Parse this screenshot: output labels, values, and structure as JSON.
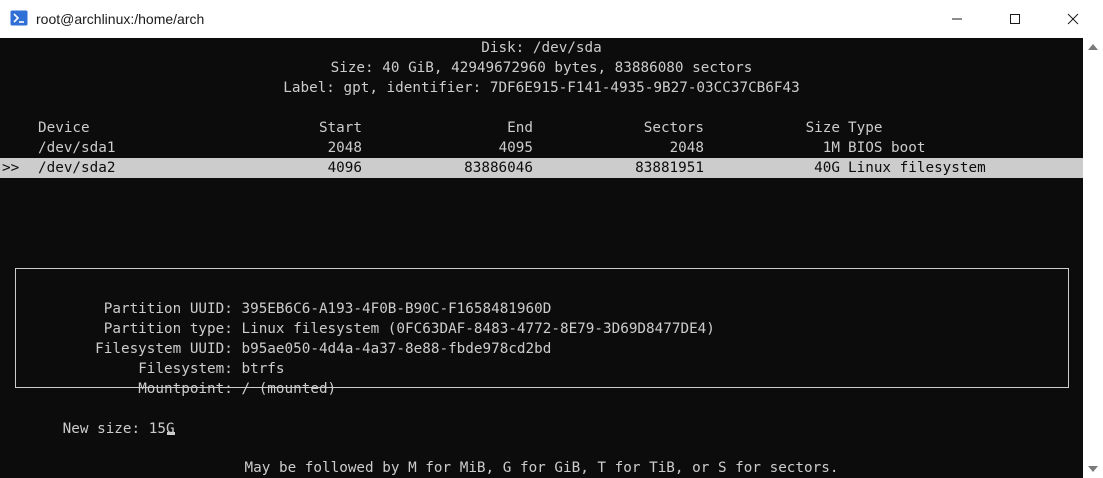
{
  "window": {
    "title": "root@archlinux:/home/arch"
  },
  "disk_header": {
    "disk": "Disk: /dev/sda",
    "size": "Size: 40 GiB, 42949672960 bytes, 83886080 sectors",
    "label": "Label: gpt, identifier: 7DF6E915-F141-4935-9B27-03CC37CB6F43"
  },
  "table": {
    "columns": {
      "device": "Device",
      "start": "Start",
      "end": "End",
      "sectors": "Sectors",
      "size": "Size",
      "type": "Type"
    },
    "rows": [
      {
        "marker": "",
        "device": "/dev/sda1",
        "start": "2048",
        "end": "4095",
        "sectors": "2048",
        "size": "1M",
        "type": "BIOS boot"
      },
      {
        "marker": ">>",
        "device": "/dev/sda2",
        "start": "4096",
        "end": "83886046",
        "sectors": "83881951",
        "size": "40G",
        "type": "Linux filesystem"
      }
    ]
  },
  "partition_info": {
    "uuid_label": "Partition UUID:",
    "uuid_value": "395EB6C6-A193-4F0B-B90C-F1658481960D",
    "type_label": "Partition type:",
    "type_value": "Linux filesystem (0FC63DAF-8483-4772-8E79-3D69D8477DE4)",
    "fs_uuid_label": "Filesystem UUID:",
    "fs_uuid_value": "b95ae050-4d4a-4a37-8e88-fbde978cd2bd",
    "fs_label": "Filesystem:",
    "fs_value": "btrfs",
    "mount_label": "Mountpoint:",
    "mount_value": "/ (mounted)"
  },
  "prompt": {
    "label": "New size: ",
    "value": "15G"
  },
  "hint": "May be followed by M for MiB, G for GiB, T for TiB, or S for sectors.",
  "colors": {
    "terminal_bg": "#0c0c0c",
    "terminal_fg": "#cccccc",
    "titlebar_bg": "#ffffff",
    "icon_blue": "#2f6fd6"
  }
}
